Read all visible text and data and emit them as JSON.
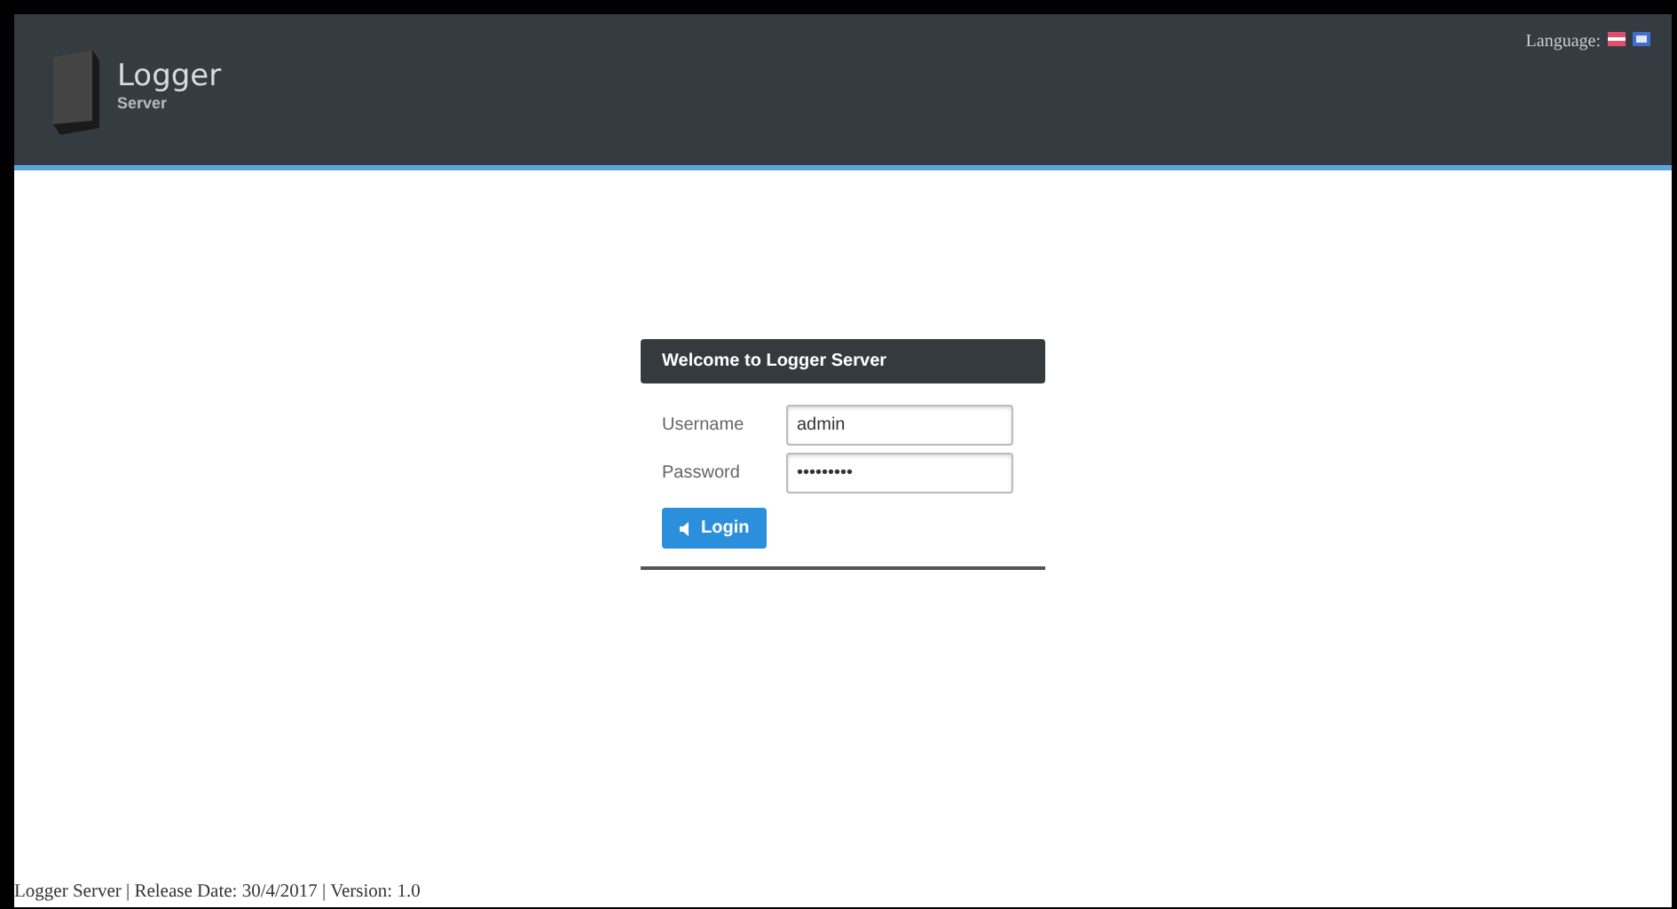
{
  "header": {
    "title": "Logger",
    "subtitle": "Server",
    "language_label": "Language:"
  },
  "login": {
    "heading": "Welcome to Logger Server",
    "fields": [
      {
        "label": "Username",
        "value": "admin"
      },
      {
        "label": "Password",
        "value": "•••••••••"
      }
    ],
    "button": "Login"
  },
  "footer": "Logger Server | Release Date: 30/4/2017 | Version: 1.0"
}
